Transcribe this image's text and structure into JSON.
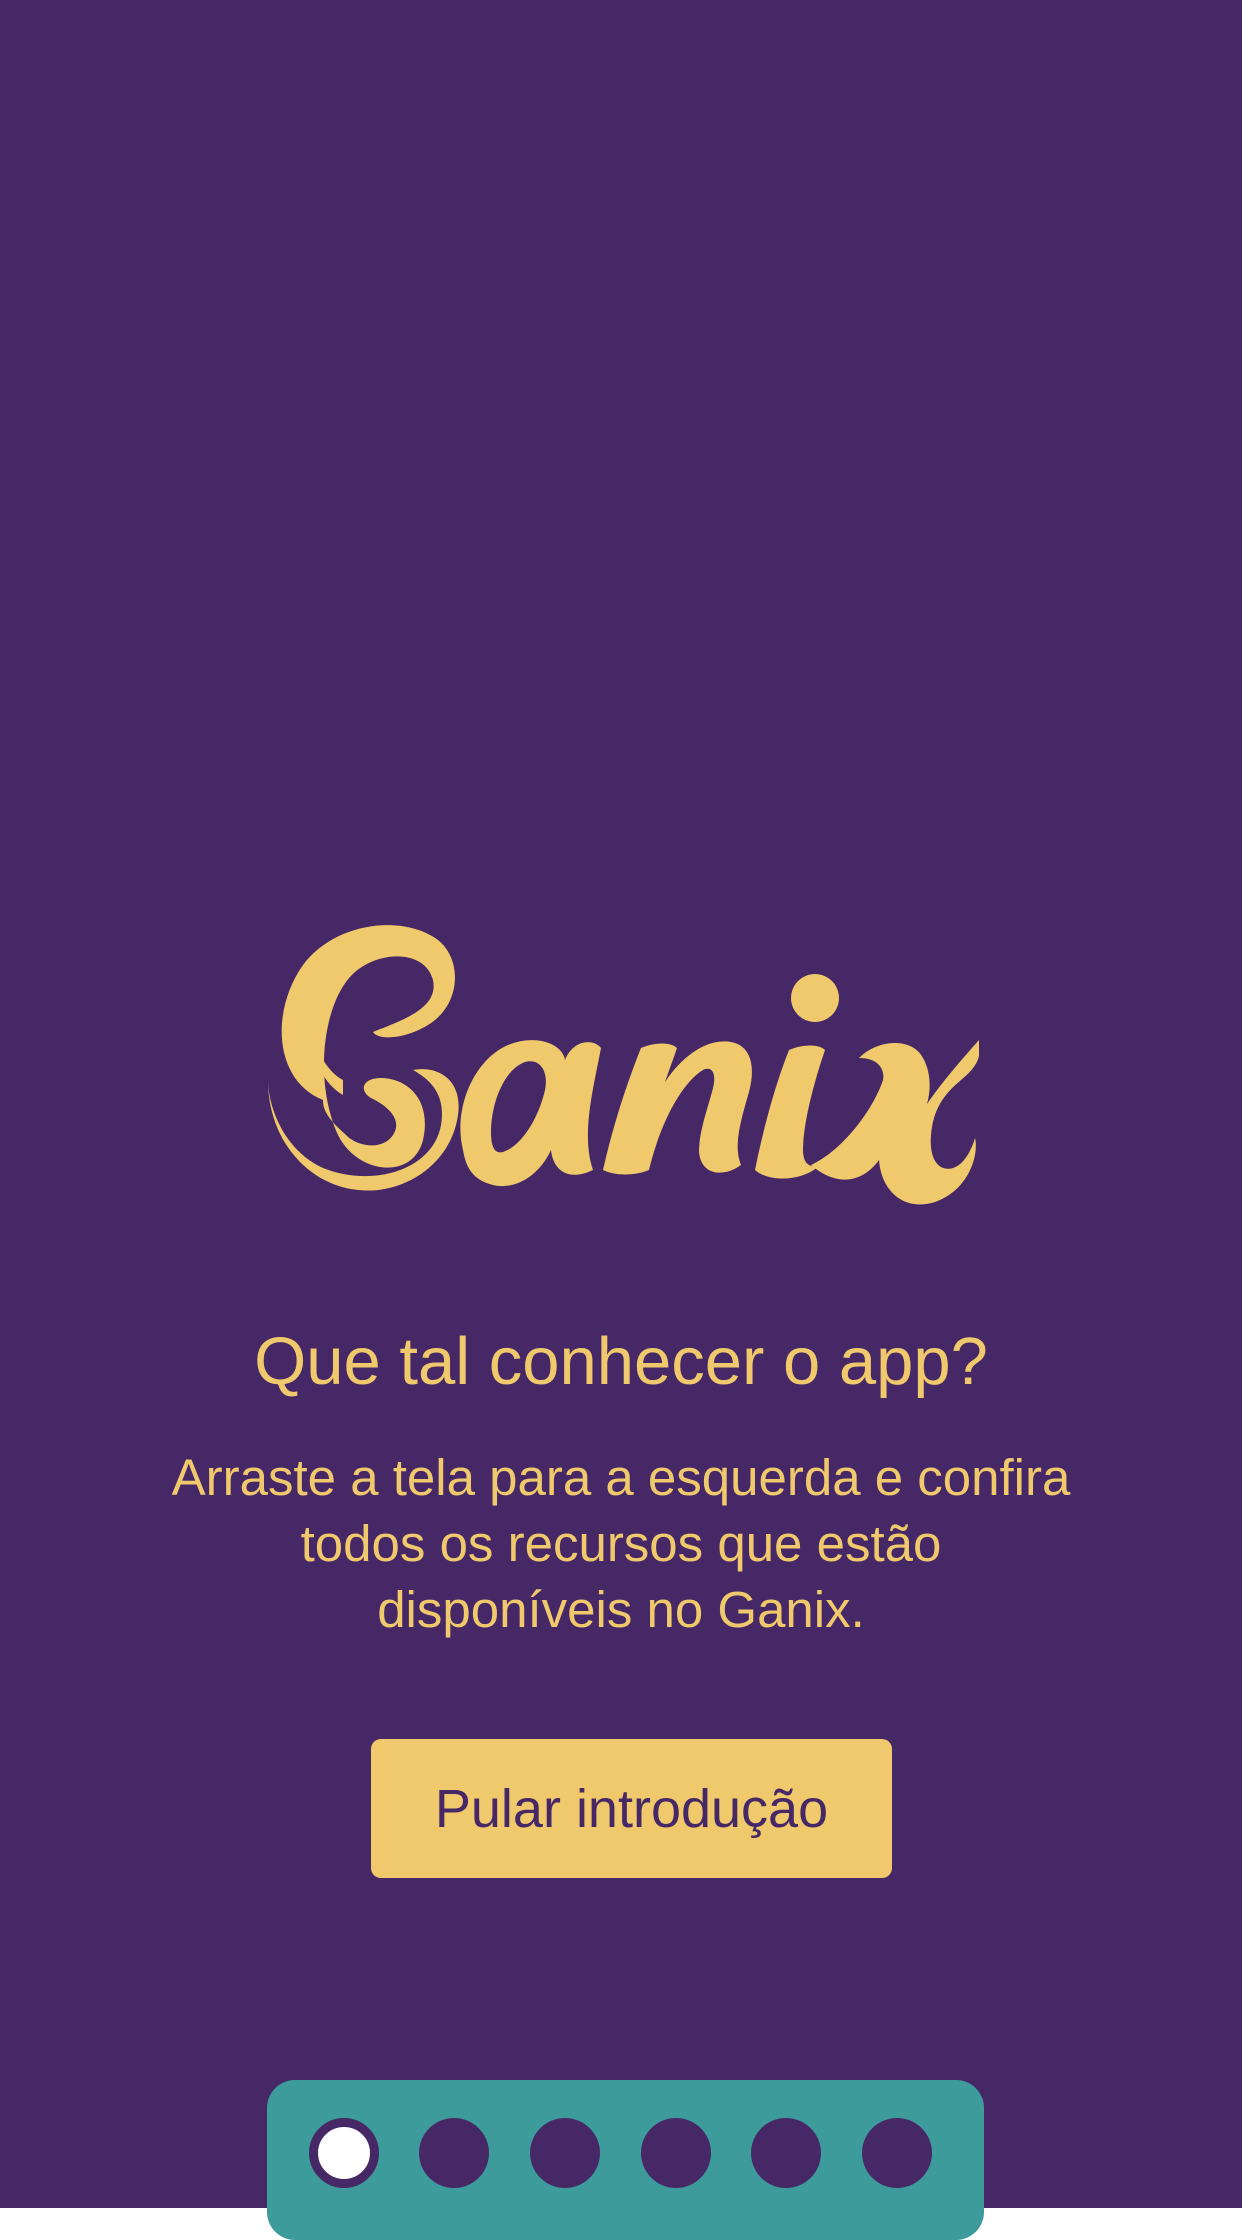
{
  "brand": {
    "logo_text": "Ganix"
  },
  "intro": {
    "headline": "Que tal conhecer o app?",
    "description": "Arraste a tela para a esquerda e confira todos os recursos que estão disponíveis no Ganix.",
    "skip_label": "Pular introdução"
  },
  "pager": {
    "page_count": 6,
    "active_index": 0
  },
  "colors": {
    "background": "#472867",
    "accent_yellow": "#efc96b",
    "pager_background": "#3e9b9b",
    "active_dot": "#ffffff"
  }
}
